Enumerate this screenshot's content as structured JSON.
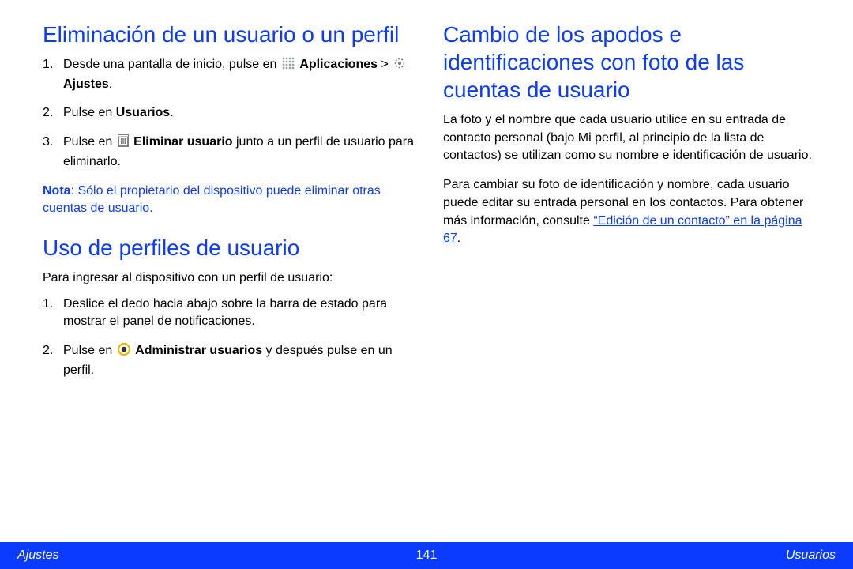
{
  "left": {
    "heading1": "Eliminación de un usuario o un perfil",
    "list1": {
      "num1": "1.",
      "item1_pre": "Desde una pantalla de inicio, pulse en ",
      "item1_apps": "Aplicaciones",
      "item1_gt": " > ",
      "item1_settings": "Ajustes",
      "item1_post": ".",
      "num2": "2.",
      "item2_pre": "Pulse en ",
      "item2_bold": "Usuarios",
      "item2_post": ".",
      "num3": "3.",
      "item3_pre": "Pulse en ",
      "item3_bold": "Eliminar usuario",
      "item3_post": " junto a un perfil de usuario para eliminarlo."
    },
    "note_label": "Nota",
    "note_text": ": Sólo el propietario del dispositivo puede eliminar otras cuentas de usuario.",
    "heading2": "Uso de perfiles de usuario",
    "lead2": "Para ingresar al dispositivo con un perfil de usuario:",
    "list2": {
      "num1": "1.",
      "item1": "Deslice el dedo hacia abajo sobre la barra de estado para mostrar el panel de notificaciones.",
      "num2": "2.",
      "item2_pre": "Pulse en ",
      "item2_bold": "Administrar usuarios",
      "item2_post": " y después pulse en un perfil."
    }
  },
  "right": {
    "heading": "Cambio de los apodos e identificaciones con foto de las cuentas de usuario",
    "para1": "La foto y el nombre que cada usuario utilice en su entrada de contacto personal (bajo Mi perfil, al principio de la lista de contactos) se utilizan como su nombre e identificación de usuario.",
    "para2_pre": "Para cambiar su foto de identificación y nombre, cada usuario puede editar su entrada personal en los contactos. Para obtener más información, consulte ",
    "para2_link": "“Edición de un contacto” en la página 67",
    "para2_post": "."
  },
  "footer": {
    "left": "Ajustes",
    "center": "141",
    "right": "Usuarios"
  }
}
